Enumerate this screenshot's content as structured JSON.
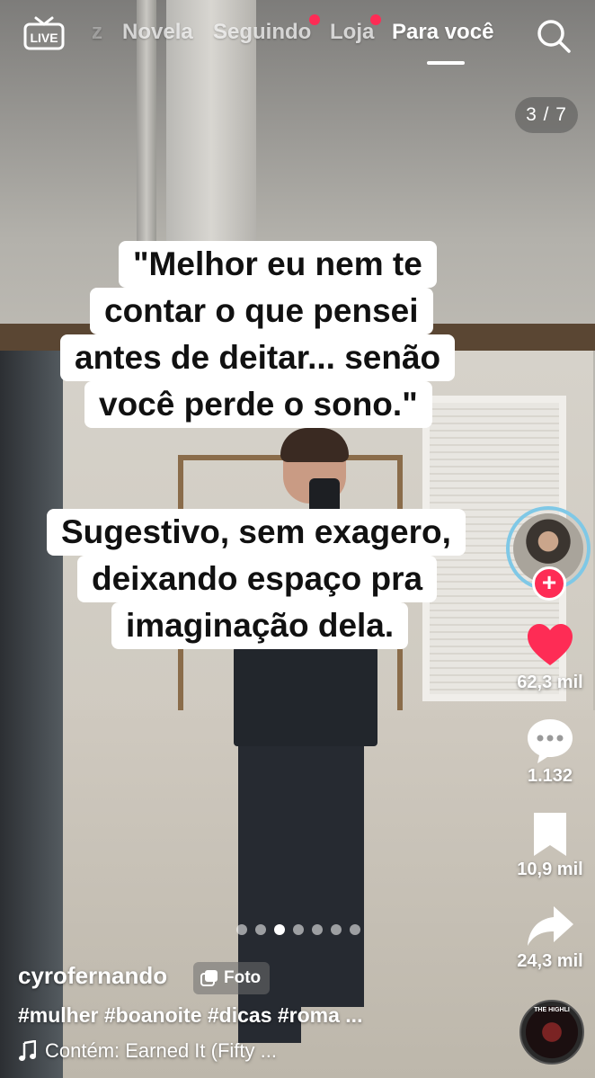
{
  "top_nav": {
    "live_label": "LIVE",
    "tabs": [
      {
        "label": "z"
      },
      {
        "label": "Novela"
      },
      {
        "label": "Seguindo"
      },
      {
        "label": "Loja"
      },
      {
        "label": "Para você"
      }
    ]
  },
  "colors": {
    "accent": "#fe2c55",
    "caption_bg": "#ffffff",
    "avatar_ring": "#7fc8e6"
  },
  "page_counter": "3 / 7",
  "captions": {
    "first": [
      "\"Melhor eu nem te",
      "contar o que pensei",
      "antes de deitar... senão",
      "você perde o sono.\""
    ],
    "second": [
      "Sugestivo, sem exagero,",
      "deixando espaço pra",
      "imaginação dela."
    ]
  },
  "rail": {
    "follow_symbol": "+",
    "likes": "62,3 mil",
    "comments": "1.132",
    "saves": "10,9 mil",
    "shares": "24,3 mil"
  },
  "carousel": {
    "total": 7,
    "current": 3
  },
  "post": {
    "username": "cyrofernando",
    "badge": "Foto",
    "hashtags": "#mulher #boanoite #dicas #roma ...",
    "music": "Contém: Earned It (Fifty ...",
    "disc_text": "THE HIGHLI"
  },
  "icons": [
    "live-icon",
    "search-icon",
    "heart-icon",
    "comment-icon",
    "bookmark-icon",
    "share-icon",
    "music-note-icon",
    "photo-icon"
  ]
}
